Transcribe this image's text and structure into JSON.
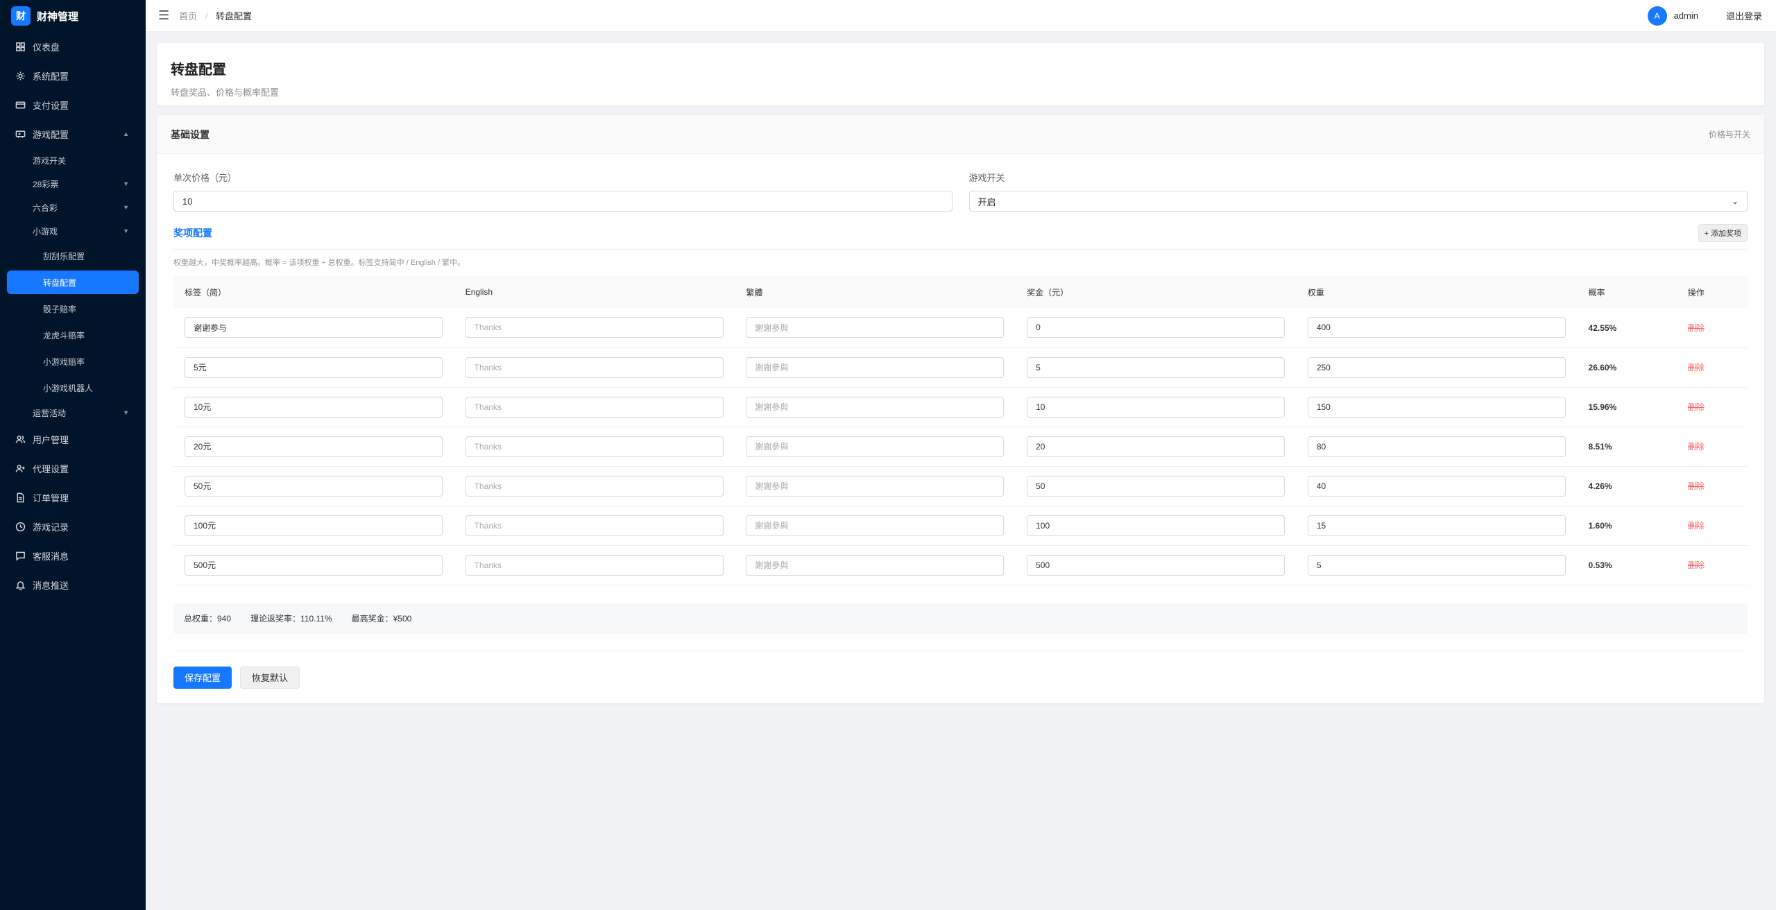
{
  "app": {
    "logo_letter": "财",
    "title": "财神管理"
  },
  "sidebar": {
    "dashboard": "仪表盘",
    "system": "系统配置",
    "payment": "支付设置",
    "game_config": "游戏配置",
    "game_switch": "游戏开关",
    "lottery28": "28彩票",
    "mark_six": "六合彩",
    "mini_games": "小游戏",
    "scratch": "刮刮乐配置",
    "wheel": "转盘配置",
    "dice": "骰子赔率",
    "dragon_tiger": "龙虎斗赔率",
    "mini_odds": "小游戏赔率",
    "mini_robot": "小游戏机器人",
    "operations": "运营活动",
    "users": "用户管理",
    "agents": "代理设置",
    "orders": "订单管理",
    "game_records": "游戏记录",
    "cs_messages": "客服消息",
    "push": "消息推送"
  },
  "header": {
    "breadcrumb_home": "首页",
    "breadcrumb_sep": "/",
    "breadcrumb_current": "转盘配置",
    "avatar_letter": "A",
    "username": "admin",
    "logout": "退出登录"
  },
  "page": {
    "title": "转盘配置",
    "subtitle": "转盘奖品、价格与概率配置"
  },
  "basic": {
    "title": "基础设置",
    "right_label": "价格与开关",
    "price_label": "单次价格（元）",
    "price_value": "10",
    "switch_label": "游戏开关",
    "switch_value": "开启"
  },
  "prizes": {
    "title": "奖项配置",
    "add_button": "+ 添加奖项",
    "hint": "权重越大，中奖概率越高。概率 = 该项权重 ÷ 总权重。标签支持简中 / English / 繁中。",
    "columns": [
      "标签（简）",
      "English",
      "繁體",
      "奖金（元）",
      "权重",
      "概率",
      "操作"
    ],
    "rows": [
      {
        "label": "谢谢参与",
        "en": "Thanks",
        "tw": "謝謝參與",
        "amount": "0",
        "weight": "400",
        "prob": "42.55%",
        "action": "删除"
      },
      {
        "label": "5元",
        "en": "Thanks",
        "tw": "謝謝參與",
        "amount": "5",
        "weight": "250",
        "prob": "26.60%",
        "action": "删除"
      },
      {
        "label": "10元",
        "en": "Thanks",
        "tw": "謝謝參與",
        "amount": "10",
        "weight": "150",
        "prob": "15.96%",
        "action": "删除"
      },
      {
        "label": "20元",
        "en": "Thanks",
        "tw": "謝謝參與",
        "amount": "20",
        "weight": "80",
        "prob": "8.51%",
        "action": "删除"
      },
      {
        "label": "50元",
        "en": "Thanks",
        "tw": "謝謝參與",
        "amount": "50",
        "weight": "40",
        "prob": "4.26%",
        "action": "删除"
      },
      {
        "label": "100元",
        "en": "Thanks",
        "tw": "謝謝參與",
        "amount": "100",
        "weight": "15",
        "prob": "1.60%",
        "action": "删除"
      },
      {
        "label": "500元",
        "en": "Thanks",
        "tw": "謝謝參與",
        "amount": "500",
        "weight": "5",
        "prob": "0.53%",
        "action": "删除"
      }
    ]
  },
  "summary": {
    "total_weight": "总权重：940",
    "return_rate": "理论返奖率：110.11%",
    "max_prize": "最高奖金：¥500"
  },
  "actions": {
    "save": "保存配置",
    "reset": "恢复默认"
  },
  "colors": {
    "sidebar_bg": "#001529",
    "primary": "#1677ff",
    "danger": "#f56c6c"
  }
}
